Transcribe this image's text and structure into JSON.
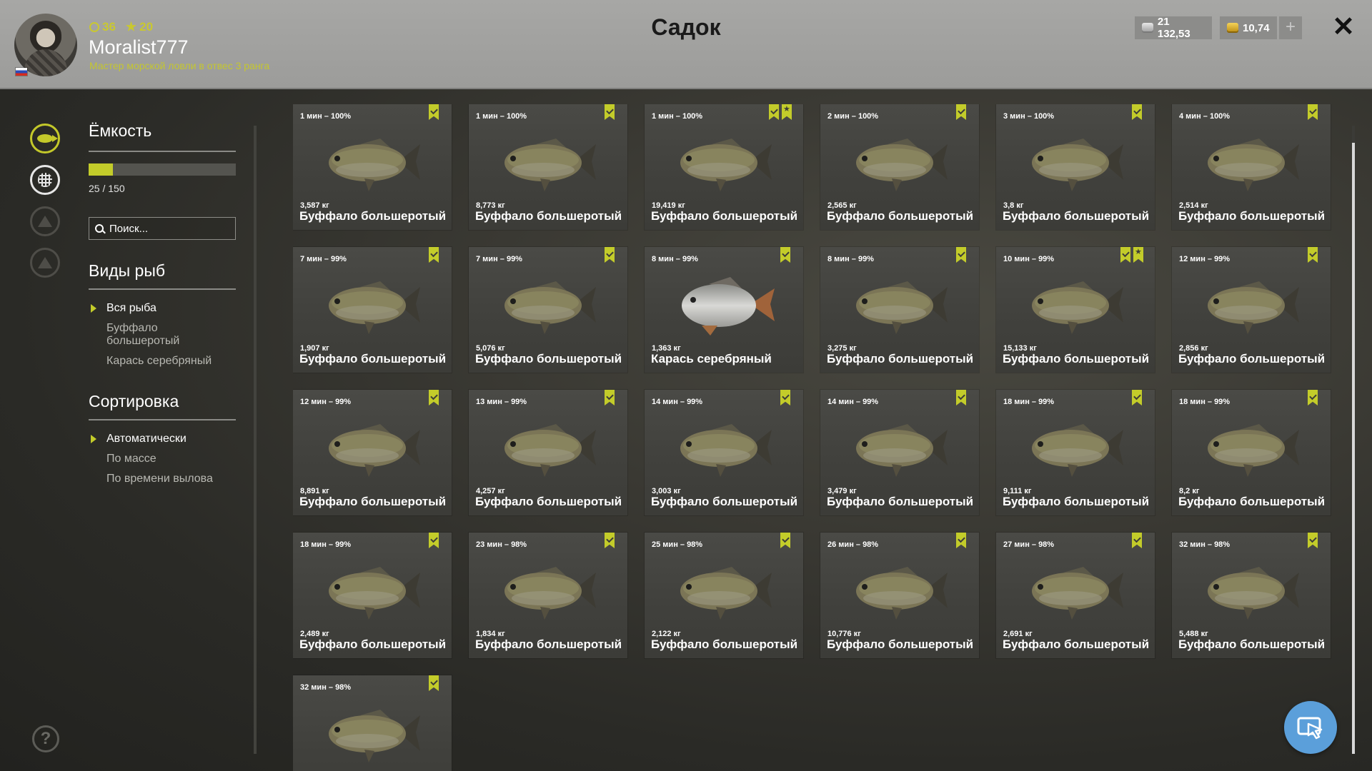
{
  "player": {
    "level": "36",
    "stars": "20",
    "username": "Moralist777",
    "rank": "Мастер морской ловли в отвес 3 ранга"
  },
  "header": {
    "title": "Садок",
    "silver": "21 132,53",
    "gold": "10,74",
    "plus_label": "+",
    "close_label": "✕"
  },
  "capacity": {
    "title": "Ёмкость",
    "current": 25,
    "max": 150,
    "text": "25 / 150"
  },
  "search": {
    "placeholder": "Поиск..."
  },
  "species": {
    "title": "Виды рыб",
    "items": [
      "Вся рыба",
      "Буффало большеротый",
      "Карась серебряный"
    ],
    "selected": 0
  },
  "sorting": {
    "title": "Сортировка",
    "items": [
      "Автоматически",
      "По массе",
      "По времени вылова"
    ],
    "selected": 0
  },
  "fish": [
    {
      "time": "1 мин – 100%",
      "weight": "3,587 кг",
      "name": "Буффало большеротый",
      "star": false,
      "kind": "buffalo"
    },
    {
      "time": "1 мин – 100%",
      "weight": "8,773 кг",
      "name": "Буффало большеротый",
      "star": false,
      "kind": "buffalo"
    },
    {
      "time": "1 мин – 100%",
      "weight": "19,419 кг",
      "name": "Буффало большеротый",
      "star": true,
      "kind": "buffalo"
    },
    {
      "time": "2 мин – 100%",
      "weight": "2,565 кг",
      "name": "Буффало большеротый",
      "star": false,
      "kind": "buffalo"
    },
    {
      "time": "3 мин – 100%",
      "weight": "3,8 кг",
      "name": "Буффало большеротый",
      "star": false,
      "kind": "buffalo"
    },
    {
      "time": "4 мин – 100%",
      "weight": "2,514 кг",
      "name": "Буффало большеротый",
      "star": false,
      "kind": "buffalo"
    },
    {
      "time": "7 мин – 99%",
      "weight": "1,907 кг",
      "name": "Буффало большеротый",
      "star": false,
      "kind": "buffalo"
    },
    {
      "time": "7 мин – 99%",
      "weight": "5,076 кг",
      "name": "Буффало большеротый",
      "star": false,
      "kind": "buffalo"
    },
    {
      "time": "8 мин – 99%",
      "weight": "1,363 кг",
      "name": "Карась серебряный",
      "star": false,
      "kind": "carp"
    },
    {
      "time": "8 мин – 99%",
      "weight": "3,275 кг",
      "name": "Буффало большеротый",
      "star": false,
      "kind": "buffalo"
    },
    {
      "time": "10 мин – 99%",
      "weight": "15,133 кг",
      "name": "Буффало большеротый",
      "star": true,
      "kind": "buffalo"
    },
    {
      "time": "12 мин – 99%",
      "weight": "2,856 кг",
      "name": "Буффало большеротый",
      "star": false,
      "kind": "buffalo"
    },
    {
      "time": "12 мин – 99%",
      "weight": "8,891 кг",
      "name": "Буффало большеротый",
      "star": false,
      "kind": "buffalo"
    },
    {
      "time": "13 мин – 99%",
      "weight": "4,257 кг",
      "name": "Буффало большеротый",
      "star": false,
      "kind": "buffalo"
    },
    {
      "time": "14 мин – 99%",
      "weight": "3,003 кг",
      "name": "Буффало большеротый",
      "star": false,
      "kind": "buffalo"
    },
    {
      "time": "14 мин – 99%",
      "weight": "3,479 кг",
      "name": "Буффало большеротый",
      "star": false,
      "kind": "buffalo"
    },
    {
      "time": "18 мин – 99%",
      "weight": "9,111 кг",
      "name": "Буффало большеротый",
      "star": false,
      "kind": "buffalo"
    },
    {
      "time": "18 мин – 99%",
      "weight": "8,2 кг",
      "name": "Буффало большеротый",
      "star": false,
      "kind": "buffalo"
    },
    {
      "time": "18 мин – 99%",
      "weight": "2,489 кг",
      "name": "Буффало большеротый",
      "star": false,
      "kind": "buffalo"
    },
    {
      "time": "23 мин – 98%",
      "weight": "1,834 кг",
      "name": "Буффало большеротый",
      "star": false,
      "kind": "buffalo"
    },
    {
      "time": "25 мин – 98%",
      "weight": "2,122 кг",
      "name": "Буффало большеротый",
      "star": false,
      "kind": "buffalo"
    },
    {
      "time": "26 мин – 98%",
      "weight": "10,776 кг",
      "name": "Буффало большеротый",
      "star": false,
      "kind": "buffalo"
    },
    {
      "time": "27 мин – 98%",
      "weight": "2,691 кг",
      "name": "Буффало большеротый",
      "star": false,
      "kind": "buffalo"
    },
    {
      "time": "32 мин – 98%",
      "weight": "5,488 кг",
      "name": "Буффало большеротый",
      "star": false,
      "kind": "buffalo"
    },
    {
      "time": "32 мин – 98%",
      "weight": "",
      "name": "",
      "star": false,
      "kind": "buffalo"
    }
  ],
  "colors": {
    "accent": "#c3cc2a",
    "header_bg": "#a3a3a1",
    "card_bg": "#45453f",
    "help_fab": "#5b9fda"
  },
  "icons": {
    "nav": [
      "fish-icon",
      "keepnet-icon",
      "camp-icon",
      "home-icon"
    ],
    "help": "question-icon",
    "fab": "cursor-icon"
  }
}
